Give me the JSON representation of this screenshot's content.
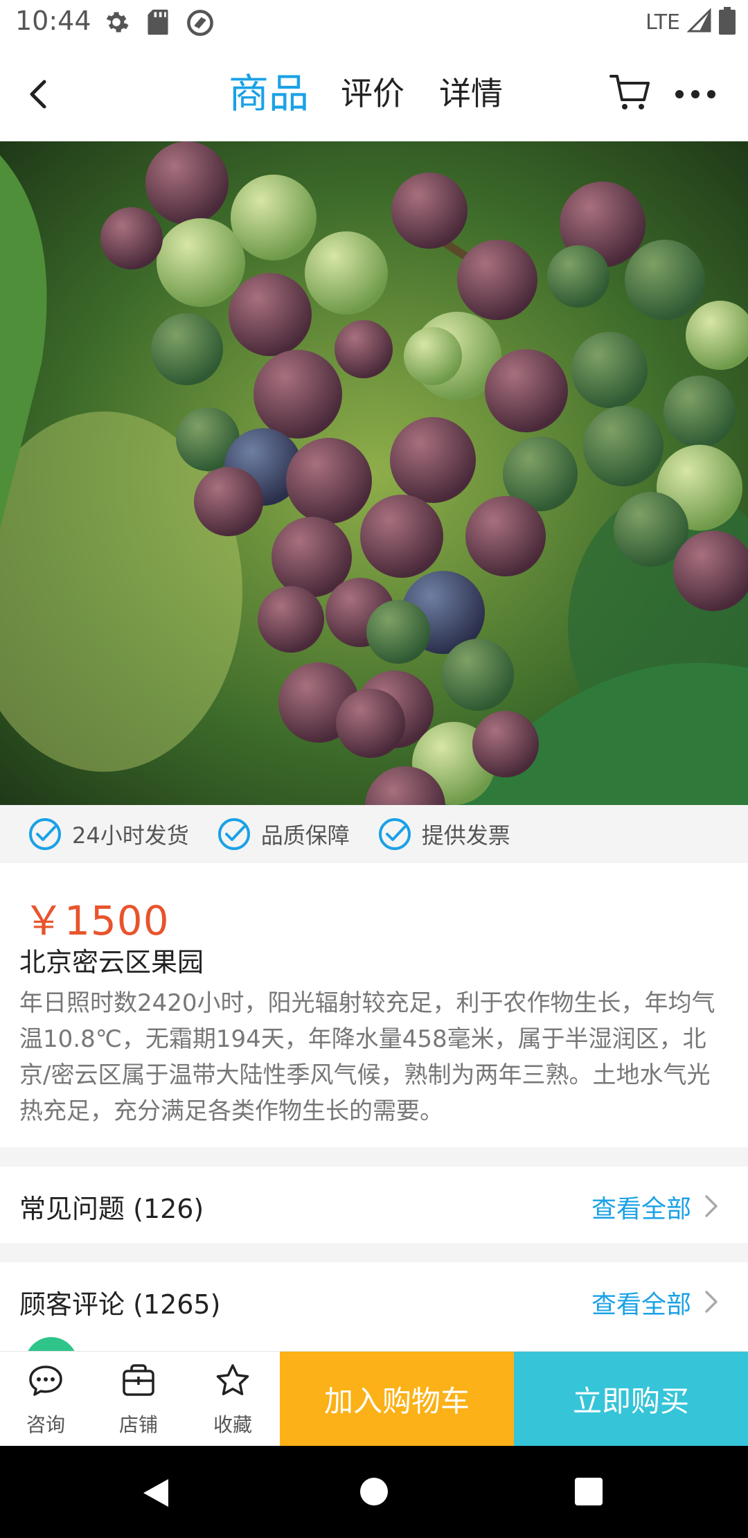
{
  "status_bar": {
    "time": "10:44",
    "network": "LTE"
  },
  "top_bar": {
    "tabs": [
      {
        "label": "商品",
        "active": true
      },
      {
        "label": "评价",
        "active": false
      },
      {
        "label": "详情",
        "active": false
      }
    ]
  },
  "guarantees": [
    "24小时发货",
    "品质保障",
    "提供发票"
  ],
  "product": {
    "price": "￥1500",
    "title": "北京密云区果园",
    "description": "年日照时数2420小时，阳光辐射较充足，利于农作物生长，年均气温10.8℃，无霜期194天，年降水量458毫米，属于半湿润区，北京/密云区属于温带大陆性季风气候，熟制为两年三熟。土地水气光热充足，充分满足各类作物生长的需要。"
  },
  "sections": {
    "faq": {
      "label": "常见问题 (126)",
      "link": "查看全部"
    },
    "reviews": {
      "label": "顾客评论 (1265)",
      "link": "查看全部"
    }
  },
  "bottom_bar": {
    "consult": "咨询",
    "store": "店铺",
    "favorite": "收藏",
    "add_to_cart": "加入购物车",
    "buy_now": "立即购买"
  },
  "colors": {
    "accent": "#1aa1e6",
    "price": "#e8542c",
    "add_to_cart_bg": "#fbb117",
    "buy_now_bg": "#36c4d8"
  },
  "icons": [
    "gear-icon",
    "sd-card-icon",
    "sync-icon",
    "signal-icon",
    "battery-icon",
    "back-arrow-icon",
    "cart-icon",
    "more-icon",
    "check-circle-icon",
    "chevron-right-icon",
    "chat-icon",
    "store-icon",
    "star-icon"
  ]
}
